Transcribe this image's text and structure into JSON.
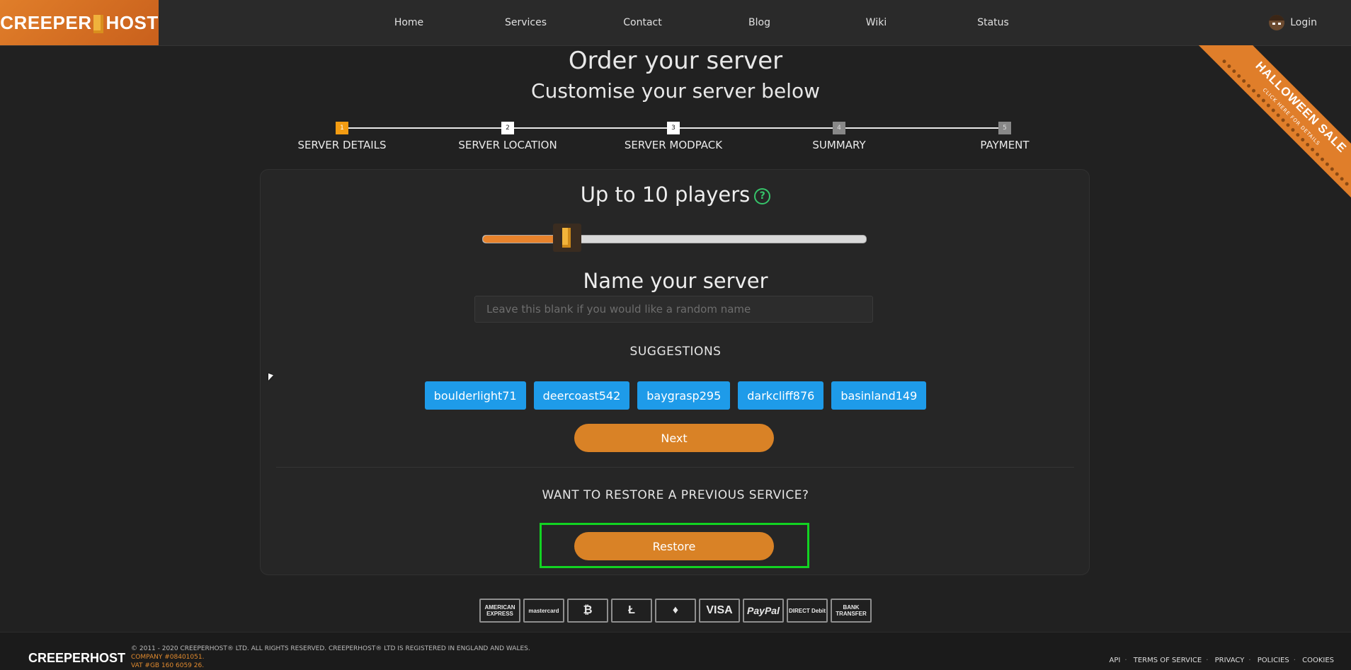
{
  "header": {
    "logo": "CREEPERHOST",
    "nav": [
      "Home",
      "Services",
      "Contact",
      "Blog",
      "Wiki",
      "Status"
    ],
    "login": "Login"
  },
  "ribbon": {
    "title": "HALLOWEEN SALE",
    "subtitle": "CLICK HERE FOR DETAILS"
  },
  "page": {
    "title": "Order your server",
    "subtitle": "Customise your server below"
  },
  "steps": [
    {
      "num": "1",
      "label": "SERVER DETAILS",
      "state": "active"
    },
    {
      "num": "2",
      "label": "SERVER LOCATION",
      "state": "normal"
    },
    {
      "num": "3",
      "label": "SERVER MODPACK",
      "state": "normal"
    },
    {
      "num": "4",
      "label": "SUMMARY",
      "state": "dim"
    },
    {
      "num": "5",
      "label": "PAYMENT",
      "state": "dim"
    }
  ],
  "players": {
    "label": "Up to 10 players",
    "help": "?",
    "slider_fraction": 0.22
  },
  "name": {
    "title": "Name your server",
    "placeholder": "Leave this blank if you would like a random name",
    "value": ""
  },
  "suggestions": {
    "title": "SUGGESTIONS",
    "items": [
      "boulderlight71",
      "deercoast542",
      "baygrasp295",
      "darkcliff876",
      "basinland149"
    ]
  },
  "next_label": "Next",
  "restore": {
    "title": "WANT TO RESTORE A PREVIOUS SERVICE?",
    "button": "Restore"
  },
  "payments": [
    "AMERICAN EXPRESS",
    "mastercard",
    "₿",
    "Ł",
    "♦",
    "VISA",
    "PayPal",
    "DIRECT Debit",
    "BANK TRANSFER"
  ],
  "footer": {
    "logo": "CREEPERHOST",
    "copyright": "© 2011 - 2020 CREEPERHOST® LTD. ALL RIGHTS RESERVED. CREEPERHOST® LTD IS REGISTERED IN ENGLAND AND WALES.",
    "company": "COMPANY #08401051.",
    "vat": "VAT #GB 160 6059 26.",
    "links": [
      "API",
      "TERMS OF SERVICE",
      "PRIVACY",
      "POLICIES",
      "COOKIES"
    ]
  },
  "colors": {
    "accent": "#d98226",
    "suggestion": "#1e9be9",
    "highlight": "#12d322"
  }
}
